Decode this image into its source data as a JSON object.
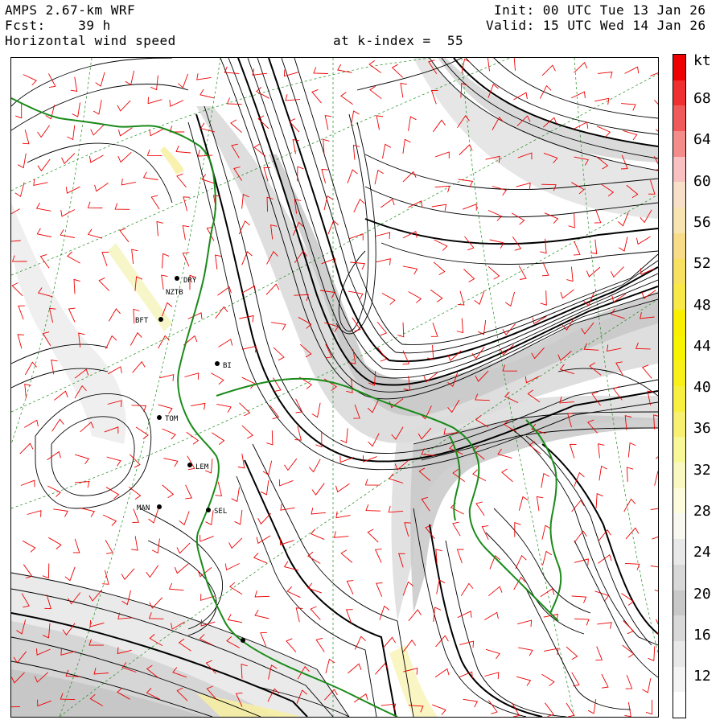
{
  "header": {
    "model": "AMPS 2.67-km WRF",
    "forecast": "Fcst:    39 h",
    "field": "Horizontal wind speed",
    "level": "at k-index =  55",
    "init": "Init: 00 UTC Tue 13 Jan 26",
    "valid": "Valid: 15 UTC Wed 14 Jan 26"
  },
  "colorbar": {
    "unit": "kt",
    "labels": [
      "68",
      "64",
      "60",
      "56",
      "52",
      "48",
      "44",
      "40",
      "36",
      "32",
      "28",
      "24",
      "20",
      "16",
      "12"
    ],
    "colors": [
      "#ee0000",
      "#f03030",
      "#f05a5a",
      "#f48c8c",
      "#f8c0c0",
      "#f8e0c8",
      "#f8e4b0",
      "#f8dc88",
      "#f8e060",
      "#f8e848",
      "#f8f000",
      "#f8f400",
      "#f8f018",
      "#f8f040",
      "#f8f070",
      "#f8f898",
      "#f8f8c0",
      "#fcfcdc",
      "#f8f8f0",
      "#e8e8e8",
      "#d8d8d8",
      "#c8c8c8",
      "#d8d8d8",
      "#e8e8e8",
      "#f4f4f4",
      "#ffffff"
    ]
  },
  "stations": [
    {
      "code": "DRY",
      "icon": "station-dot"
    },
    {
      "code": "NZTB",
      "icon": "station-dot"
    },
    {
      "code": "BFT",
      "icon": "station-dot"
    },
    {
      "code": "BI",
      "icon": "station-dot"
    },
    {
      "code": "TOM",
      "icon": "station-dot"
    },
    {
      "code": "LEM",
      "icon": "station-dot"
    },
    {
      "code": "SEL",
      "icon": "station-dot"
    },
    {
      "code": "MAN",
      "icon": "station-dot"
    }
  ],
  "colors": {
    "coastline": "#1a8a1a",
    "barbs": "#ee0000",
    "contours": "#000000",
    "graticule": "#1a8a1a"
  }
}
